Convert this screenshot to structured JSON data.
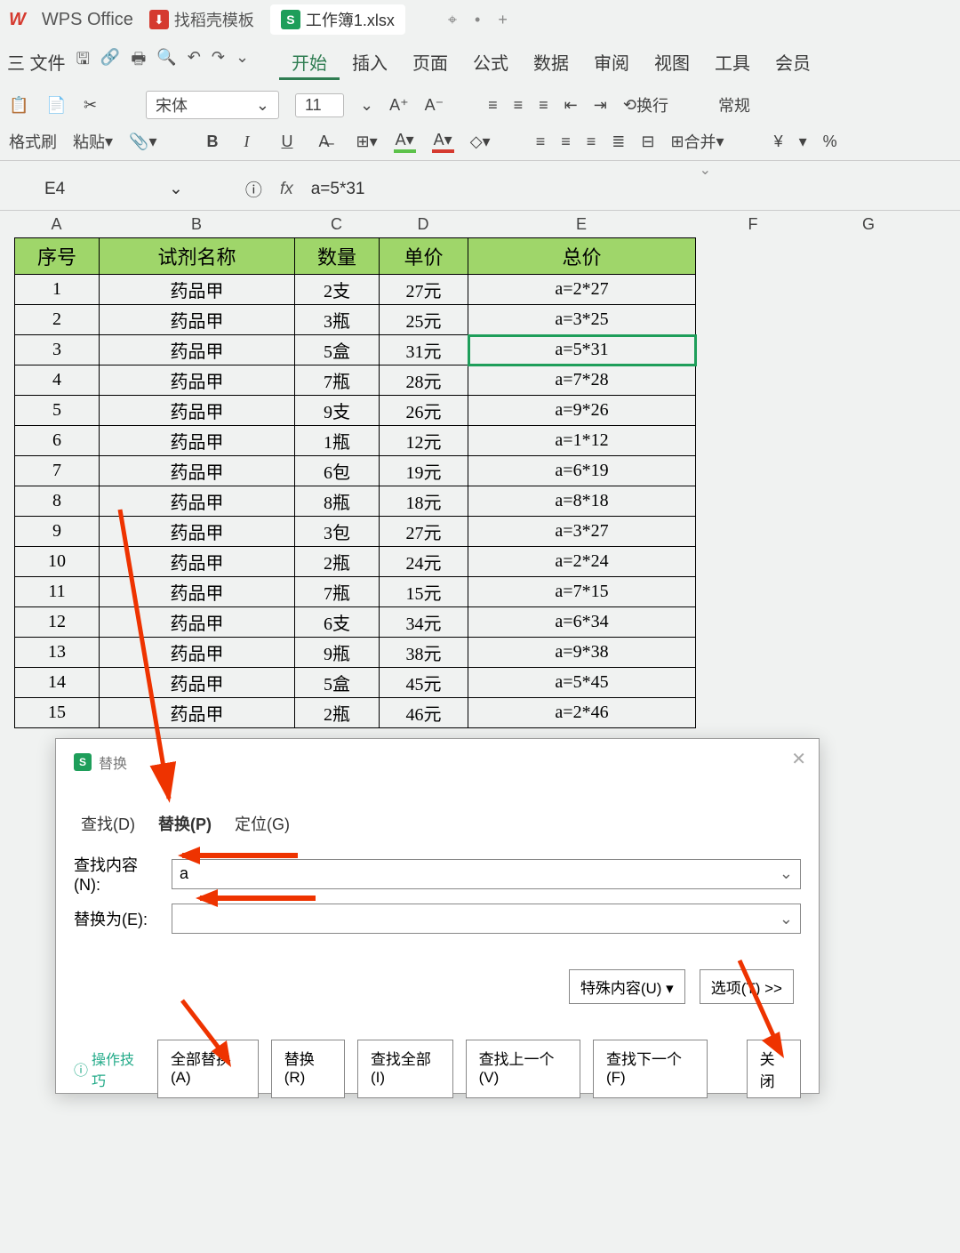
{
  "titlebar": {
    "wps_logo": "W",
    "wps_text": "WPS Office",
    "templates_tab": "找稻壳模板",
    "file_tab": "工作簿1.xlsx",
    "plus": "+"
  },
  "menubar": {
    "file": "三 文件",
    "items": [
      "开始",
      "插入",
      "页面",
      "公式",
      "数据",
      "审阅",
      "视图",
      "工具",
      "会员"
    ],
    "active_index": 0
  },
  "ribbon": {
    "font_name": "宋体",
    "font_size": "11",
    "wrap": "换行",
    "number_format": "常规",
    "format_painter": "格式刷",
    "paste": "粘贴",
    "merge": "合并",
    "currency": "¥",
    "percent": "%"
  },
  "formula_bar": {
    "name_box": "E4",
    "fx": "fx",
    "formula": "a=5*31"
  },
  "columns": [
    "A",
    "B",
    "C",
    "D",
    "E",
    "F",
    "G"
  ],
  "table": {
    "headers": [
      "序号",
      "试剂名称",
      "数量",
      "单价",
      "总价"
    ],
    "rows": [
      [
        "1",
        "药品甲",
        "2支",
        "27元",
        "a=2*27"
      ],
      [
        "2",
        "药品甲",
        "3瓶",
        "25元",
        "a=3*25"
      ],
      [
        "3",
        "药品甲",
        "5盒",
        "31元",
        "a=5*31"
      ],
      [
        "4",
        "药品甲",
        "7瓶",
        "28元",
        "a=7*28"
      ],
      [
        "5",
        "药品甲",
        "9支",
        "26元",
        "a=9*26"
      ],
      [
        "6",
        "药品甲",
        "1瓶",
        "12元",
        "a=1*12"
      ],
      [
        "7",
        "药品甲",
        "6包",
        "19元",
        "a=6*19"
      ],
      [
        "8",
        "药品甲",
        "8瓶",
        "18元",
        "a=8*18"
      ],
      [
        "9",
        "药品甲",
        "3包",
        "27元",
        "a=3*27"
      ],
      [
        "10",
        "药品甲",
        "2瓶",
        "24元",
        "a=2*24"
      ],
      [
        "11",
        "药品甲",
        "7瓶",
        "15元",
        "a=7*15"
      ],
      [
        "12",
        "药品甲",
        "6支",
        "34元",
        "a=6*34"
      ],
      [
        "13",
        "药品甲",
        "9瓶",
        "38元",
        "a=9*38"
      ],
      [
        "14",
        "药品甲",
        "5盒",
        "45元",
        "a=5*45"
      ],
      [
        "15",
        "药品甲",
        "2瓶",
        "46元",
        "a=2*46"
      ]
    ],
    "selected_row": 2,
    "selected_col": 4
  },
  "dialog": {
    "title": "替换",
    "tabs": [
      "查找(D)",
      "替换(P)",
      "定位(G)"
    ],
    "active_tab": 1,
    "find_label": "查找内容(N):",
    "find_value": "a",
    "find_placeholder": "",
    "replace_label": "替换为(E):",
    "replace_value": "",
    "special": "特殊内容(U)",
    "options": "选项(T) >>",
    "tip": "操作技巧",
    "buttons": [
      "全部替换(A)",
      "替换(R)",
      "查找全部(I)",
      "查找上一个(V)",
      "查找下一个(F)",
      "关闭"
    ]
  }
}
